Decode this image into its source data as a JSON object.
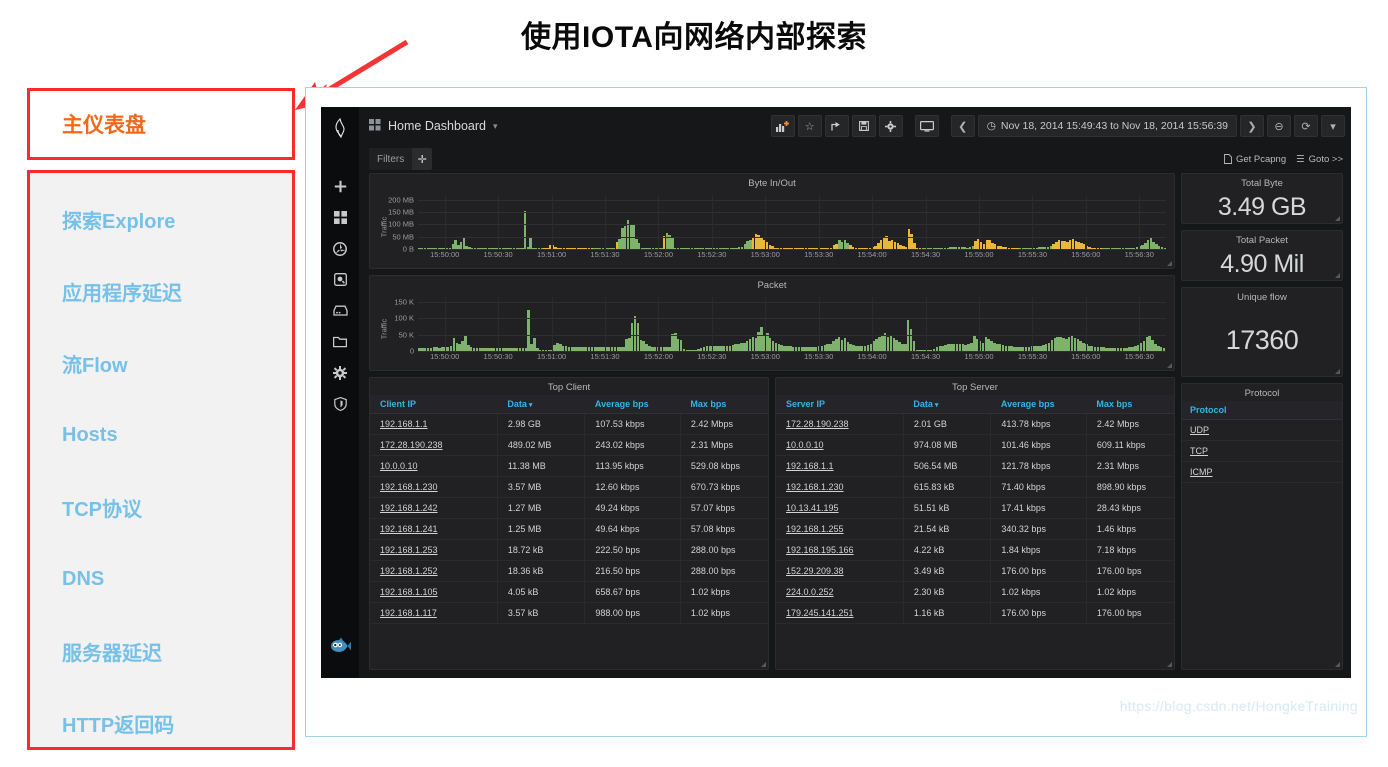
{
  "slide": {
    "title": "使用IOTA向网络内部探索",
    "watermark": "https://blog.csdn.net/HongkeTraining"
  },
  "colors": {
    "accent_orange": "#f2681a",
    "menu_blue": "#77c1e8",
    "frame_red": "#fc2b2b",
    "grafana_bg": "#161719",
    "panel_bg": "#212124",
    "link_blue": "#33b5e5",
    "bar_green": "#7eb26d",
    "bar_yellow": "#eab839"
  },
  "left_menu": {
    "active_item": {
      "label": "主仪表盘"
    },
    "items": [
      {
        "label": "探索Explore"
      },
      {
        "label": "应用程序延迟"
      },
      {
        "label": "流Flow"
      },
      {
        "label": "Hosts"
      },
      {
        "label": "TCP协议"
      },
      {
        "label": "DNS"
      },
      {
        "label": "服务器延迟"
      },
      {
        "label": "HTTP返回码"
      }
    ]
  },
  "grafana": {
    "nav_icons": [
      {
        "name": "plus-icon"
      },
      {
        "name": "dashboards-grid-icon"
      },
      {
        "name": "explore-compass-icon"
      },
      {
        "name": "alerting-icon"
      },
      {
        "name": "server-icon"
      },
      {
        "name": "folder-icon"
      },
      {
        "name": "gear-icon"
      },
      {
        "name": "shield-icon"
      }
    ],
    "logo_name": "grafana-logo-icon",
    "avatar_name": "user-avatar-fish-icon",
    "topbar": {
      "dashboard_title": "Home Dashboard",
      "dashboard_caret": "▾",
      "buttons": [
        {
          "name": "add-panel-button",
          "glyph": "▁▅▇"
        },
        {
          "name": "star-button",
          "glyph": "☆"
        },
        {
          "name": "share-button",
          "glyph": "↪"
        },
        {
          "name": "save-button",
          "glyph": "▤"
        },
        {
          "name": "settings-gear-button",
          "glyph": "✷"
        },
        {
          "name": "tv-mode-button",
          "glyph": "🖵"
        }
      ],
      "time_prev": "❮",
      "time_range": "Nov 18, 2014 15:49:43 to Nov 18, 2014 15:56:39",
      "time_clock_icon": "◷",
      "time_next": "❯",
      "zoom_out": "⊖",
      "refresh": "⟳",
      "refresh_caret": "▾"
    },
    "filters": {
      "label": "Filters",
      "add": "✛",
      "get_pcapng": "Get Pcapng",
      "get_pcapng_icon": "🗎",
      "goto": "Goto >>",
      "goto_icon": "☰"
    },
    "panels": {
      "byte_in_out": {
        "title": "Byte In/Out"
      },
      "packet": {
        "title": "Packet"
      },
      "top_client": {
        "title": "Top Client"
      },
      "top_server": {
        "title": "Top Server"
      },
      "protocol": {
        "title": "Protocol"
      },
      "total_byte": {
        "title": "Total Byte",
        "value": "3.49 GB"
      },
      "total_packet": {
        "title": "Total Packet",
        "value": "4.90 Mil"
      },
      "unique_flow": {
        "title": "Unique flow",
        "value": "17360"
      }
    },
    "top_client_table": {
      "columns": [
        "Client IP",
        "Data",
        "Average bps",
        "Max bps"
      ],
      "sorted_column": "Data",
      "sort_caret": "▾",
      "rows": [
        [
          "192.168.1.1",
          "2.98 GB",
          "107.53 kbps",
          "2.42 Mbps"
        ],
        [
          "172.28.190.238",
          "489.02 MB",
          "243.02 kbps",
          "2.31 Mbps"
        ],
        [
          "10.0.0.10",
          "11.38 MB",
          "113.95 kbps",
          "529.08 kbps"
        ],
        [
          "192.168.1.230",
          "3.57 MB",
          "12.60 kbps",
          "670.73 kbps"
        ],
        [
          "192.168.1.242",
          "1.27 MB",
          "49.24 kbps",
          "57.07 kbps"
        ],
        [
          "192.168.1.241",
          "1.25 MB",
          "49.64 kbps",
          "57.08 kbps"
        ],
        [
          "192.168.1.253",
          "18.72 kB",
          "222.50 bps",
          "288.00 bps"
        ],
        [
          "192.168.1.252",
          "18.36 kB",
          "216.50 bps",
          "288.00 bps"
        ],
        [
          "192.168.1.105",
          "4.05 kB",
          "658.67 bps",
          "1.02 kbps"
        ],
        [
          "192.168.1.117",
          "3.57 kB",
          "988.00 bps",
          "1.02 kbps"
        ]
      ]
    },
    "top_server_table": {
      "columns": [
        "Server IP",
        "Data",
        "Average bps",
        "Max bps"
      ],
      "sorted_column": "Data",
      "sort_caret": "▾",
      "rows": [
        [
          "172.28.190.238",
          "2.01 GB",
          "413.78 kbps",
          "2.42 Mbps"
        ],
        [
          "10.0.0.10",
          "974.08 MB",
          "101.46 kbps",
          "609.11 kbps"
        ],
        [
          "192.168.1.1",
          "506.54 MB",
          "121.78 kbps",
          "2.31 Mbps"
        ],
        [
          "192.168.1.230",
          "615.83 kB",
          "71.40 kbps",
          "898.90 kbps"
        ],
        [
          "10.13.41.195",
          "51.51 kB",
          "17.41 kbps",
          "28.43 kbps"
        ],
        [
          "192.168.1.255",
          "21.54 kB",
          "340.32 bps",
          "1.46 kbps"
        ],
        [
          "192.168.195.166",
          "4.22 kB",
          "1.84 kbps",
          "7.18 kbps"
        ],
        [
          "152.29.209.38",
          "3.49 kB",
          "176.00 bps",
          "176.00 bps"
        ],
        [
          "224.0.0.252",
          "2.30 kB",
          "1.02 kbps",
          "1.02 kbps"
        ],
        [
          "179.245.141.251",
          "1.16 kB",
          "176.00 bps",
          "176.00 bps"
        ]
      ]
    },
    "protocol_table": {
      "columns": [
        "Protocol"
      ],
      "rows": [
        [
          "UDP"
        ],
        [
          "TCP"
        ],
        [
          "ICMP"
        ]
      ]
    }
  },
  "chart_data": [
    {
      "type": "bar",
      "title": "Byte In/Out",
      "xlabel": "",
      "ylabel": "Traffic",
      "ylim": [
        0,
        220
      ],
      "yticks": [
        "0 B",
        "50 MB",
        "100 MB",
        "150 MB",
        "200 MB"
      ],
      "ytick_values": [
        0,
        50,
        100,
        150,
        200
      ],
      "xticks": [
        "15:50:00",
        "15:50:30",
        "15:51:00",
        "15:51:30",
        "15:52:00",
        "15:52:30",
        "15:53:00",
        "15:53:30",
        "15:54:00",
        "15:54:30",
        "15:55:00",
        "15:55:30",
        "15:56:00",
        "15:56:30"
      ],
      "grid": true,
      "legend": "none",
      "units": "MB",
      "series": [
        {
          "name": "Byte In/Out",
          "values": [
            2,
            2,
            3,
            2,
            2,
            2,
            3,
            2,
            2,
            2,
            3,
            4,
            22,
            38,
            18,
            30,
            45,
            12,
            8,
            3,
            2,
            2,
            2,
            2,
            2,
            2,
            2,
            2,
            2,
            2,
            3,
            2,
            2,
            2,
            2,
            2,
            2,
            2,
            155,
            8,
            50,
            3,
            2,
            2,
            2,
            2,
            2,
            16,
            18,
            10,
            4,
            2,
            2,
            2,
            2,
            2,
            2,
            2,
            2,
            2,
            2,
            2,
            2,
            2,
            2,
            2,
            2,
            2,
            2,
            2,
            3,
            28,
            40,
            85,
            95,
            118,
            97,
            96,
            42,
            24,
            4,
            3,
            2,
            2,
            2,
            2,
            2,
            2,
            52,
            65,
            58,
            46,
            4,
            2,
            2,
            2,
            2,
            2,
            2,
            2,
            2,
            2,
            2,
            2,
            2,
            2,
            2,
            2,
            4,
            5,
            4,
            5,
            4,
            4,
            6,
            8,
            10,
            22,
            34,
            38,
            48,
            62,
            56,
            44,
            38,
            30,
            18,
            12,
            6,
            4,
            4,
            3,
            3,
            3,
            3,
            3,
            3,
            2,
            2,
            2,
            2,
            2,
            2,
            2,
            2,
            4,
            4,
            5,
            6,
            16,
            22,
            36,
            30,
            38,
            24,
            16,
            8,
            6,
            5,
            4,
            4,
            5,
            6,
            8,
            14,
            26,
            38,
            44,
            52,
            34,
            38,
            30,
            24,
            18,
            12,
            10,
            82,
            62,
            26,
            4,
            3,
            2,
            2,
            2,
            2,
            2,
            2,
            4,
            5,
            6,
            6,
            8,
            10,
            8,
            10,
            10,
            8,
            6,
            10,
            14,
            34,
            40,
            28,
            20,
            36,
            38,
            26,
            20,
            14,
            12,
            10,
            8,
            6,
            6,
            5,
            5,
            4,
            4,
            4,
            5,
            5,
            6,
            6,
            7,
            7,
            8,
            10,
            14,
            22,
            30,
            36,
            34,
            32,
            30,
            36,
            40,
            34,
            30,
            26,
            20,
            14,
            10,
            6,
            5,
            4,
            4,
            3,
            3,
            3,
            3,
            3,
            4,
            4,
            4,
            4,
            4,
            5,
            6,
            8,
            12,
            18,
            26,
            38,
            44,
            30,
            20,
            12,
            8,
            6
          ],
          "color_rule": "green for in, yellow for out"
        }
      ]
    },
    {
      "type": "bar",
      "title": "Packet",
      "xlabel": "",
      "ylabel": "Traffic",
      "ylim": [
        0,
        165
      ],
      "yticks": [
        "0",
        "50 K",
        "100 K",
        "150 K"
      ],
      "ytick_values": [
        0,
        50,
        100,
        150
      ],
      "xticks": [
        "15:50:00",
        "15:50:30",
        "15:51:00",
        "15:51:30",
        "15:52:00",
        "15:52:30",
        "15:53:00",
        "15:53:30",
        "15:54:00",
        "15:54:30",
        "15:55:00",
        "15:55:30",
        "15:56:00",
        "15:56:30"
      ],
      "grid": true,
      "legend": "none",
      "units": "K packets",
      "series": [
        {
          "name": "Packet",
          "values": [
            8,
            9,
            10,
            9,
            10,
            11,
            12,
            10,
            11,
            12,
            11,
            14,
            40,
            26,
            20,
            30,
            45,
            18,
            12,
            10,
            10,
            9,
            9,
            10,
            10,
            9,
            10,
            9,
            10,
            9,
            10,
            9,
            10,
            9,
            9,
            10,
            10,
            10,
            126,
            20,
            40,
            8,
            4,
            2,
            2,
            2,
            4,
            18,
            26,
            22,
            16,
            14,
            13,
            12,
            12,
            12,
            13,
            12,
            12,
            11,
            12,
            11,
            12,
            12,
            12,
            13,
            12,
            12,
            11,
            12,
            12,
            13,
            36,
            40,
            86,
            108,
            86,
            34,
            32,
            22,
            16,
            12,
            12,
            12,
            11,
            12,
            12,
            12,
            52,
            54,
            36,
            34,
            6,
            3,
            2,
            2,
            2,
            6,
            10,
            12,
            14,
            14,
            14,
            14,
            15,
            14,
            14,
            15,
            16,
            18,
            20,
            22,
            24,
            26,
            30,
            36,
            44,
            40,
            58,
            74,
            48,
            56,
            40,
            30,
            24,
            20,
            18,
            16,
            14,
            14,
            13,
            13,
            12,
            12,
            12,
            12,
            12,
            13,
            12,
            14,
            16,
            18,
            20,
            22,
            30,
            36,
            42,
            34,
            40,
            28,
            22,
            18,
            16,
            14,
            14,
            16,
            18,
            22,
            30,
            38,
            44,
            48,
            56,
            44,
            46,
            40,
            34,
            28,
            22,
            20,
            96,
            66,
            30,
            4,
            3,
            2,
            2,
            2,
            2,
            6,
            12,
            14,
            16,
            18,
            20,
            22,
            20,
            22,
            22,
            20,
            18,
            22,
            26,
            48,
            38,
            30,
            26,
            44,
            38,
            30,
            26,
            22,
            20,
            18,
            16,
            14,
            14,
            13,
            13,
            12,
            12,
            12,
            13,
            14,
            14,
            16,
            16,
            18,
            20,
            26,
            34,
            40,
            44,
            42,
            40,
            38,
            44,
            46,
            40,
            36,
            30,
            26,
            20,
            16,
            14,
            12,
            12,
            11,
            11,
            10,
            10,
            10,
            10,
            10,
            10,
            10,
            10,
            11,
            12,
            14,
            18,
            24,
            32,
            44,
            50,
            34,
            22,
            14,
            12,
            10
          ],
          "color_rule": "all green"
        }
      ]
    }
  ]
}
